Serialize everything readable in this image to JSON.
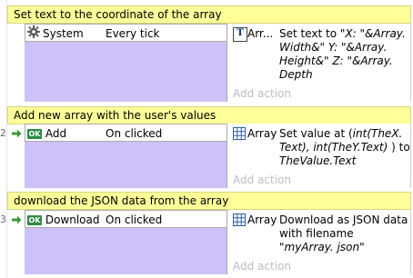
{
  "events": [
    {
      "number": "",
      "comment": "Set text to the coordinate of the array",
      "condition": {
        "object": "System",
        "object_icon": "gear-icon",
        "text": "Every tick"
      },
      "action": {
        "object": "Arr...",
        "object_icon": "text-object-icon",
        "text_parts": [
          {
            "t": "Set text to ",
            "i": false
          },
          {
            "t": "\"X: \"&Array.",
            "i": true
          },
          {
            "t": " ",
            "i": false
          },
          {
            "t": "Width&\" Y: \"&Array.",
            "i": true
          },
          {
            "t": " ",
            "i": false
          },
          {
            "t": "Height&\" Z: \"&Array.",
            "i": true
          },
          {
            "t": " ",
            "i": false
          },
          {
            "t": "Depth",
            "i": true
          }
        ]
      },
      "add_action": "Add action"
    },
    {
      "number": "2",
      "comment": "Add new array with the user's values",
      "condition": {
        "object": "Add",
        "object_icon": "ok-button-icon",
        "text": "On clicked"
      },
      "action": {
        "object": "Array",
        "object_icon": "array-grid-icon",
        "text_parts": [
          {
            "t": "Set value at (",
            "i": false
          },
          {
            "t": "int(TheX.",
            "i": true
          },
          {
            "t": " ",
            "i": false
          },
          {
            "t": "Text), int(TheY.Text)",
            "i": true
          },
          {
            "t": " ) to ",
            "i": false
          },
          {
            "t": "TheValue.Text",
            "i": true
          }
        ]
      },
      "add_action": "Add action"
    },
    {
      "number": "3",
      "comment": "download the JSON data from the array",
      "condition": {
        "object": "Download",
        "object_icon": "ok-button-icon",
        "text": "On clicked"
      },
      "action": {
        "object": "Array",
        "object_icon": "array-grid-icon",
        "text_parts": [
          {
            "t": "Download as JSON data with filename ",
            "i": false
          },
          {
            "t": "\"myArray.",
            "i": true
          },
          {
            "t": " ",
            "i": false
          },
          {
            "t": "json\"",
            "i": true
          }
        ]
      },
      "add_action": "Add action"
    }
  ],
  "ok_icon_label": "OK",
  "text_icon_label": "T",
  "colors": {
    "comment_bg": "#ffff99",
    "condition_bg": "#cdc1f7",
    "ok_green": "#2e8b43"
  }
}
